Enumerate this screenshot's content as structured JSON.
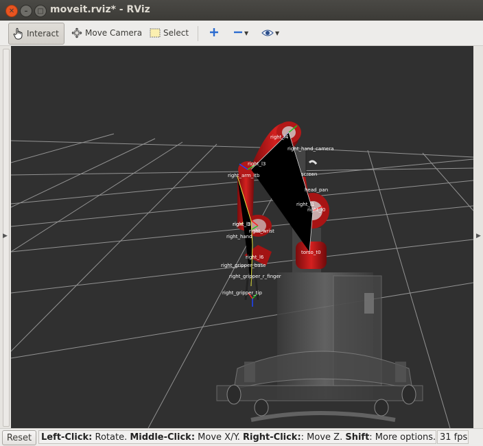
{
  "window": {
    "title": "moveit.rviz* - RViz",
    "close_glyph": "✕",
    "min_glyph": "–",
    "max_glyph": "□"
  },
  "toolbar": {
    "interact_label": "Interact",
    "move_camera_label": "Move Camera",
    "select_label": "Select",
    "icons": [
      "hand-pointer-icon",
      "camera-move-icon",
      "select-rect-icon",
      "plus-icon",
      "minus-icon",
      "eye-icon"
    ]
  },
  "viewport": {
    "background": "#303030",
    "grid_color": "#a0a0a0",
    "robot_color": "#c0181a",
    "frame_labels": [
      "right_l4",
      "right_l3",
      "right_hand_camera",
      "right_arm_itb",
      "head_pan",
      "screen",
      "right_l2",
      "right_l0",
      "right_l1",
      "right_l5",
      "right_wrist",
      "right_hand",
      "right_l6",
      "right_gripper_base",
      "right_gripper_r_finger",
      "right_gripper_tip",
      "torso_t0"
    ]
  },
  "status": {
    "reset_label": "Reset",
    "left_click_key": "Left-Click:",
    "left_click_action": " Rotate. ",
    "middle_click_key": "Middle-Click:",
    "middle_click_action": " Move X/Y. ",
    "right_click_key": "Right-Click:",
    "right_click_action": ": Move Z. ",
    "shift_key": "Shift",
    "shift_action": ": More options.",
    "fps": "31 fps"
  }
}
